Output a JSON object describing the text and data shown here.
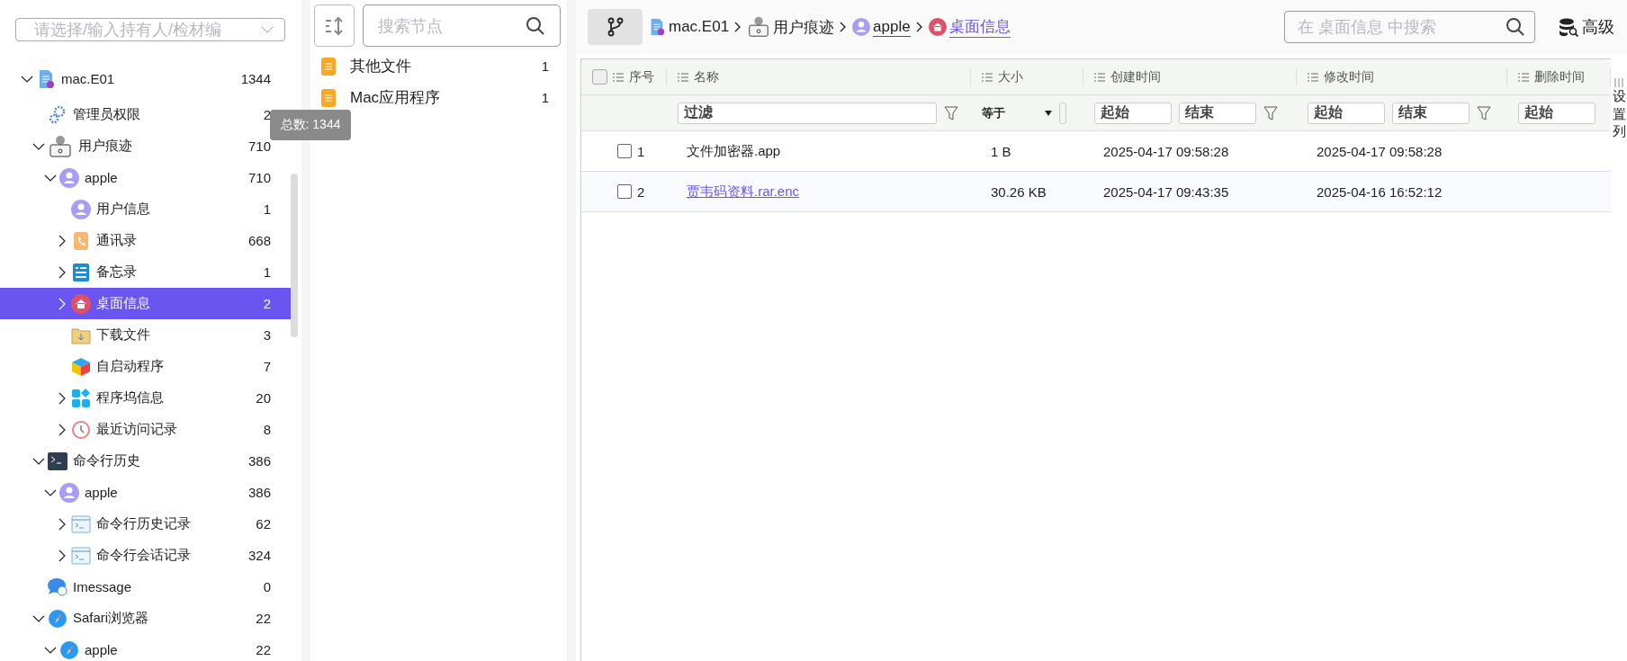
{
  "owner_select": {
    "placeholder": "请选择/输入持有人/检材编"
  },
  "tree": [
    {
      "label": "mac.E01",
      "count": "1344",
      "kind": "file",
      "expanded": true,
      "selected": false,
      "children": [
        {
          "label": "管理员权限",
          "count": "2",
          "kind": "gears",
          "selected": false
        },
        {
          "label": "用户痕迹",
          "count": "710",
          "kind": "user-box",
          "expanded": true,
          "selected": false,
          "children": [
            {
              "label": "apple",
              "count": "710",
              "kind": "person",
              "expanded": true,
              "selected": false,
              "children": [
                {
                  "label": "用户信息",
                  "count": "1",
                  "kind": "person",
                  "selected": false
                },
                {
                  "label": "通讯录",
                  "count": "668",
                  "kind": "phone",
                  "expanded": false,
                  "selected": false
                },
                {
                  "label": "备忘录",
                  "count": "1",
                  "kind": "notes",
                  "expanded": false,
                  "selected": false
                },
                {
                  "label": "桌面信息",
                  "count": "2",
                  "kind": "home",
                  "expanded": false,
                  "selected": true
                },
                {
                  "label": "下载文件",
                  "count": "3",
                  "kind": "folder",
                  "selected": false
                },
                {
                  "label": "自启动程序",
                  "count": "7",
                  "kind": "cube",
                  "selected": false
                },
                {
                  "label": "程序坞信息",
                  "count": "20",
                  "kind": "grid",
                  "expanded": false,
                  "selected": false
                },
                {
                  "label": "最近访问记录",
                  "count": "8",
                  "kind": "clock",
                  "expanded": false,
                  "selected": false
                }
              ]
            }
          ]
        },
        {
          "label": "命令行历史",
          "count": "386",
          "kind": "terminal",
          "expanded": true,
          "selected": false,
          "children": [
            {
              "label": "apple",
              "count": "386",
              "kind": "person",
              "expanded": true,
              "selected": false,
              "children": [
                {
                  "label": "命令行历史记录",
                  "count": "62",
                  "kind": "console",
                  "expanded": false,
                  "selected": false
                },
                {
                  "label": "命令行会话记录",
                  "count": "324",
                  "kind": "console",
                  "expanded": false,
                  "selected": false
                }
              ]
            }
          ]
        },
        {
          "label": "Imessage",
          "count": "0",
          "kind": "chat",
          "selected": false
        },
        {
          "label": "Safari浏览器",
          "count": "22",
          "kind": "compass",
          "expanded": true,
          "selected": false,
          "children": [
            {
              "label": "apple",
              "count": "22",
              "kind": "compass",
              "expanded": true,
              "selected": false
            }
          ]
        }
      ]
    }
  ],
  "tooltip": "总数: 1344",
  "node_search": {
    "placeholder": "搜索节点"
  },
  "node_list": [
    {
      "label": "其他文件",
      "count": "1"
    },
    {
      "label": "Mac应用程序",
      "count": "1"
    }
  ],
  "breadcrumb": [
    {
      "label": "mac.E01",
      "kind": "file",
      "current": false
    },
    {
      "label": "用户痕迹",
      "kind": "user-box",
      "current": false
    },
    {
      "label": "apple",
      "kind": "person",
      "current": false
    },
    {
      "label": "桌面信息",
      "kind": "home",
      "current": true
    }
  ],
  "content_search": {
    "placeholder": "在 桌面信息 中搜索"
  },
  "advanced_button": "高级",
  "table": {
    "all_checked": false,
    "columns": [
      {
        "label": "序号",
        "kind": "none"
      },
      {
        "label": "名称",
        "kind": "text",
        "placeholder": "过滤"
      },
      {
        "label": "大小",
        "kind": "select",
        "value": "等于"
      },
      {
        "label": "创建时间",
        "kind": "range",
        "from": "起始",
        "to": "结束"
      },
      {
        "label": "修改时间",
        "kind": "range",
        "from": "起始",
        "to": "结束"
      },
      {
        "label": "删除时间",
        "kind": "start",
        "from": "起始"
      }
    ],
    "rows": [
      {
        "index": "1",
        "name": "文件加密器.app",
        "link": false,
        "checked": false,
        "size": "1 B",
        "created": "2025-04-17 09:58:28",
        "modified": "2025-04-17 09:58:28"
      },
      {
        "index": "2",
        "name": "贾韦码资料.rar.enc",
        "link": true,
        "checked": false,
        "size": "30.26 KB",
        "created": "2025-04-17 09:43:35",
        "modified": "2025-04-16 16:52:12"
      }
    ]
  },
  "column_settings": "设置列"
}
